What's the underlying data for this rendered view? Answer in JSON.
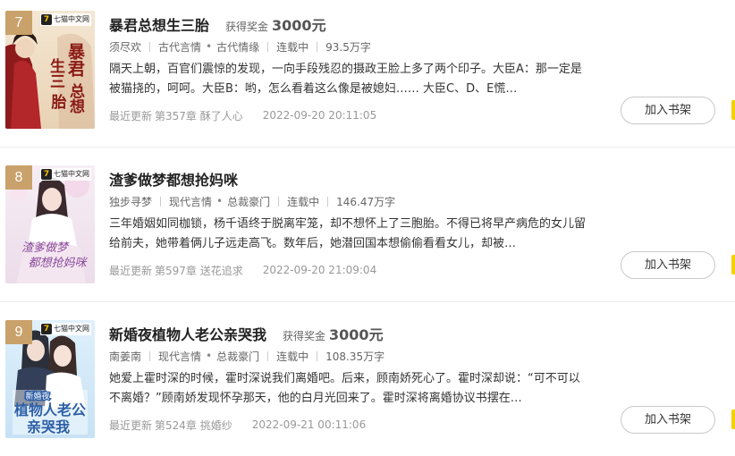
{
  "books": [
    {
      "rank": "7",
      "title": "暴君总想生三胎",
      "award_label": "获得奖金",
      "award_amount": "3000元",
      "author": "须尽欢",
      "category": "古代言情",
      "subcategory": "古代情缘",
      "status": "连载中",
      "word_count": "93.5万字",
      "description": "隔天上朝，百官们震惊的发现，一向手段残忍的摄政王脸上多了两个印子。大臣A：那一定是被猫挠的，呵呵。大臣B：哟，怎么看着这么像是被媳妇…… 大臣C、D、E慌…",
      "update_label": "最近更新",
      "latest_chapter": "第357章 酥了人心",
      "update_time": "2022-09-20 20:11:05",
      "shelf_button": "加入书架",
      "publisher_tag": "七猫中文网",
      "cover_text": "暴君总想生三胎"
    },
    {
      "rank": "8",
      "title": "渣爹做梦都想抢妈咪",
      "award_label": "",
      "award_amount": "",
      "author": "独步寻梦",
      "category": "现代言情",
      "subcategory": "总裁豪门",
      "status": "连载中",
      "word_count": "146.47万字",
      "description": "三年婚姻如同枷锁，杨千语终于脱离牢笼，却不想怀上了三胞胎。不得已将早产病危的女儿留给前夫，她带着俩儿子远走高飞。数年后，她潜回国本想偷偷看看女儿，却被…",
      "update_label": "最近更新",
      "latest_chapter": "第597章 送花追求",
      "update_time": "2022-09-20 21:09:04",
      "shelf_button": "加入书架",
      "publisher_tag": "七猫中文网",
      "cover_text": "渣爹做梦都想抢妈咪"
    },
    {
      "rank": "9",
      "title": "新婚夜植物人老公亲哭我",
      "award_label": "获得奖金",
      "award_amount": "3000元",
      "author": "南姜南",
      "category": "现代言情",
      "subcategory": "总裁豪门",
      "status": "连载中",
      "word_count": "108.35万字",
      "description": "她爱上霍时深的时候，霍时深说我们离婚吧。后来，顾南娇死心了。霍时深却说：“可不可以不离婚？”顾南娇发现怀孕那天，他的白月光回来了。霍时深将离婚协议书摆在…",
      "update_label": "最近更新",
      "latest_chapter": "第524章 挑婚纱",
      "update_time": "2022-09-21 00:11:06",
      "shelf_button": "加入书架",
      "publisher_tag": "七猫中文网",
      "cover_text": "新婚夜植物人老公亲哭我"
    }
  ],
  "colors": {
    "rank_badge": "#c9a16a",
    "accent_edge": "#f5d000",
    "divider": "#ececec"
  },
  "icons": {
    "publisher_logo": "qimao-logo-icon"
  }
}
